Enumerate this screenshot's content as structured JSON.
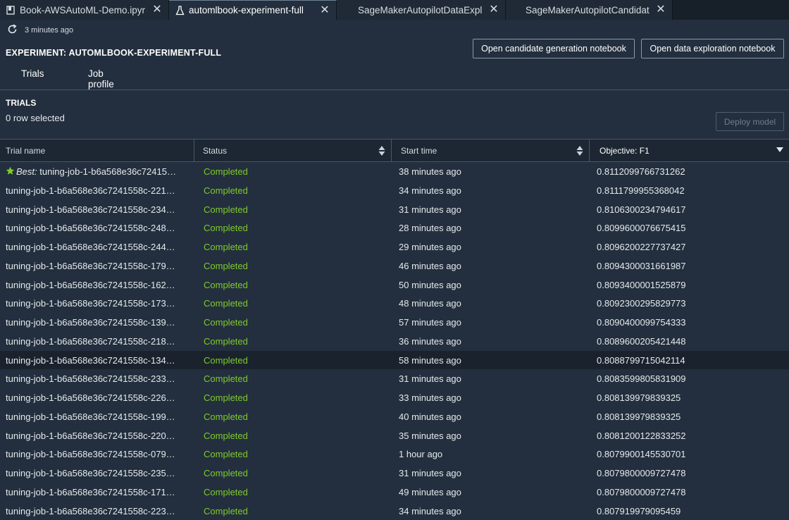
{
  "tabs": [
    {
      "label": "Book-AWSAutoML-Demo.ipyr",
      "icon": "notebook-icon",
      "active": false
    },
    {
      "label": "automlbook-experiment-full",
      "icon": "flask-icon",
      "active": true
    },
    {
      "label": "SageMakerAutopilotDataExpl",
      "icon": "",
      "active": false
    },
    {
      "label": "SageMakerAutopilotCandidat",
      "icon": "",
      "active": false
    }
  ],
  "refresh": {
    "text": "3 minutes ago",
    "icon": "refresh-icon"
  },
  "experiment": {
    "title": "EXPERIMENT: AUTOMLBOOK-EXPERIMENT-FULL"
  },
  "buttons": {
    "candidate_notebook": "Open candidate generation notebook",
    "data_exploration_notebook": "Open data exploration notebook",
    "deploy_model": "Deploy model"
  },
  "subtabs": [
    "Trials",
    "Job profile"
  ],
  "trials": {
    "title": "TRIALS",
    "selected_text": "0 row selected",
    "columns": [
      "Trial name",
      "Status",
      "Start time",
      "Objective: F1"
    ],
    "best_label": "Best:",
    "rows": [
      {
        "name": "tuning-job-1-b6a568e36c72415…",
        "status": "Completed",
        "start": "38 minutes ago",
        "objective": "0.8112099766731262",
        "best": true
      },
      {
        "name": "tuning-job-1-b6a568e36c7241558c-221…",
        "status": "Completed",
        "start": "34 minutes ago",
        "objective": "0.8111799955368042"
      },
      {
        "name": "tuning-job-1-b6a568e36c7241558c-234…",
        "status": "Completed",
        "start": "31 minutes ago",
        "objective": "0.8106300234794617"
      },
      {
        "name": "tuning-job-1-b6a568e36c7241558c-248…",
        "status": "Completed",
        "start": "28 minutes ago",
        "objective": "0.8099600076675415"
      },
      {
        "name": "tuning-job-1-b6a568e36c7241558c-244…",
        "status": "Completed",
        "start": "29 minutes ago",
        "objective": "0.8096200227737427"
      },
      {
        "name": "tuning-job-1-b6a568e36c7241558c-179…",
        "status": "Completed",
        "start": "46 minutes ago",
        "objective": "0.8094300031661987"
      },
      {
        "name": "tuning-job-1-b6a568e36c7241558c-162…",
        "status": "Completed",
        "start": "50 minutes ago",
        "objective": "0.8093400001525879"
      },
      {
        "name": "tuning-job-1-b6a568e36c7241558c-173…",
        "status": "Completed",
        "start": "48 minutes ago",
        "objective": "0.8092300295829773"
      },
      {
        "name": "tuning-job-1-b6a568e36c7241558c-139…",
        "status": "Completed",
        "start": "57 minutes ago",
        "objective": "0.8090400099754333"
      },
      {
        "name": "tuning-job-1-b6a568e36c7241558c-218…",
        "status": "Completed",
        "start": "36 minutes ago",
        "objective": "0.8089600205421448"
      },
      {
        "name": "tuning-job-1-b6a568e36c7241558c-134…",
        "status": "Completed",
        "start": "58 minutes ago",
        "objective": "0.8088799715042114",
        "highlight": true
      },
      {
        "name": "tuning-job-1-b6a568e36c7241558c-233…",
        "status": "Completed",
        "start": "31 minutes ago",
        "objective": "0.8083599805831909"
      },
      {
        "name": "tuning-job-1-b6a568e36c7241558c-226…",
        "status": "Completed",
        "start": "33 minutes ago",
        "objective": "0.808139979839325"
      },
      {
        "name": "tuning-job-1-b6a568e36c7241558c-199…",
        "status": "Completed",
        "start": "40 minutes ago",
        "objective": "0.808139979839325"
      },
      {
        "name": "tuning-job-1-b6a568e36c7241558c-220…",
        "status": "Completed",
        "start": "35 minutes ago",
        "objective": "0.8081200122833252"
      },
      {
        "name": "tuning-job-1-b6a568e36c7241558c-079…",
        "status": "Completed",
        "start": "1 hour ago",
        "objective": "0.8079900145530701"
      },
      {
        "name": "tuning-job-1-b6a568e36c7241558c-235…",
        "status": "Completed",
        "start": "31 minutes ago",
        "objective": "0.8079800009727478"
      },
      {
        "name": "tuning-job-1-b6a568e36c7241558c-171…",
        "status": "Completed",
        "start": "49 minutes ago",
        "objective": "0.8079800009727478"
      },
      {
        "name": "tuning-job-1-b6a568e36c7241558c-223…",
        "status": "Completed",
        "start": "34 minutes ago",
        "objective": "0.807919979095459"
      }
    ]
  },
  "colors": {
    "status_completed": "#7fca2c",
    "best_star": "#7fca2c",
    "background": "#232f3e"
  }
}
